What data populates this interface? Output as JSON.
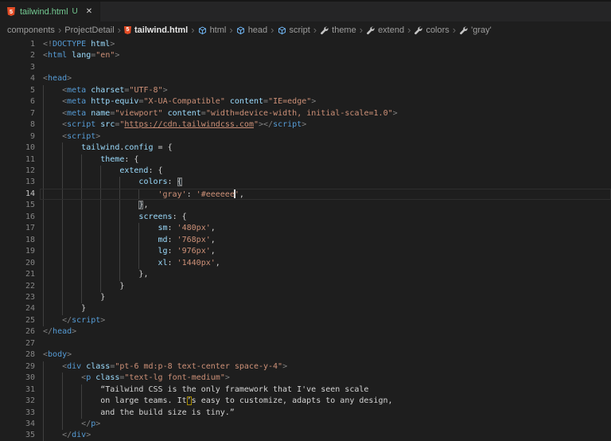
{
  "tab": {
    "label": "tailwind.html",
    "git_status": "U",
    "close_glyph": "✕",
    "file_icon_text": "5"
  },
  "breadcrumb": {
    "separator": "›",
    "items": [
      {
        "label": "components",
        "icon": null
      },
      {
        "label": "ProjectDetail",
        "icon": null
      },
      {
        "label": "tailwind.html",
        "icon": "html5",
        "emphasis": true
      },
      {
        "label": "html",
        "icon": "cube"
      },
      {
        "label": "head",
        "icon": "cube"
      },
      {
        "label": "script",
        "icon": "cube"
      },
      {
        "label": "theme",
        "icon": "wrench"
      },
      {
        "label": "extend",
        "icon": "wrench"
      },
      {
        "label": "colors",
        "icon": "wrench"
      },
      {
        "label": "'gray'",
        "icon": "wrench"
      }
    ]
  },
  "editor": {
    "active_line": 14,
    "token_colors": {
      "p": "#808080",
      "t": "#569cd6",
      "a": "#9cdcfe",
      "s": "#ce9178",
      "k": "#9cdcfe",
      "w": "#d4d4d4"
    },
    "ui_colors": {
      "background": "#1e1e1e",
      "tab_bar": "#252526",
      "untracked_green": "#73c991",
      "line_number": "#858585",
      "active_line_number": "#c6c6c6",
      "indent_guide": "#404040"
    },
    "lines": [
      {
        "n": 1,
        "indent": 0,
        "tokens": [
          [
            "<!",
            "p"
          ],
          [
            "DOCTYPE",
            "t"
          ],
          [
            " ",
            "w"
          ],
          [
            "html",
            "a"
          ],
          [
            ">",
            "p"
          ]
        ]
      },
      {
        "n": 2,
        "indent": 0,
        "tokens": [
          [
            "<",
            "p"
          ],
          [
            "html",
            "t"
          ],
          [
            " ",
            "w"
          ],
          [
            "lang",
            "a"
          ],
          [
            "=",
            "p"
          ],
          [
            "\"en\"",
            "s"
          ],
          [
            ">",
            "p"
          ]
        ]
      },
      {
        "n": 3,
        "indent": 0,
        "tokens": []
      },
      {
        "n": 4,
        "indent": 0,
        "tokens": [
          [
            "<",
            "p"
          ],
          [
            "head",
            "t"
          ],
          [
            ">",
            "p"
          ]
        ]
      },
      {
        "n": 5,
        "indent": 4,
        "tokens": [
          [
            "    ",
            "w"
          ],
          [
            "<",
            "p"
          ],
          [
            "meta",
            "t"
          ],
          [
            " ",
            "w"
          ],
          [
            "charset",
            "a"
          ],
          [
            "=",
            "p"
          ],
          [
            "\"UTF-8\"",
            "s"
          ],
          [
            ">",
            "p"
          ]
        ]
      },
      {
        "n": 6,
        "indent": 4,
        "tokens": [
          [
            "    ",
            "w"
          ],
          [
            "<",
            "p"
          ],
          [
            "meta",
            "t"
          ],
          [
            " ",
            "w"
          ],
          [
            "http-equiv",
            "a"
          ],
          [
            "=",
            "p"
          ],
          [
            "\"X-UA-Compatible\"",
            "s"
          ],
          [
            " ",
            "w"
          ],
          [
            "content",
            "a"
          ],
          [
            "=",
            "p"
          ],
          [
            "\"IE=edge\"",
            "s"
          ],
          [
            ">",
            "p"
          ]
        ]
      },
      {
        "n": 7,
        "indent": 4,
        "tokens": [
          [
            "    ",
            "w"
          ],
          [
            "<",
            "p"
          ],
          [
            "meta",
            "t"
          ],
          [
            " ",
            "w"
          ],
          [
            "name",
            "a"
          ],
          [
            "=",
            "p"
          ],
          [
            "\"viewport\"",
            "s"
          ],
          [
            " ",
            "w"
          ],
          [
            "content",
            "a"
          ],
          [
            "=",
            "p"
          ],
          [
            "\"width=device-width, initial-scale=1.0\"",
            "s"
          ],
          [
            ">",
            "p"
          ]
        ]
      },
      {
        "n": 8,
        "indent": 4,
        "tokens": [
          [
            "    ",
            "w"
          ],
          [
            "<",
            "p"
          ],
          [
            "script",
            "t"
          ],
          [
            " ",
            "w"
          ],
          [
            "src",
            "a"
          ],
          [
            "=",
            "p"
          ],
          [
            "\"",
            "s"
          ],
          [
            "https://cdn.tailwindcss.com",
            "s",
            "link"
          ],
          [
            "\"",
            "s"
          ],
          [
            ">",
            "p"
          ],
          [
            "</",
            "p"
          ],
          [
            "script",
            "t"
          ],
          [
            ">",
            "p"
          ]
        ]
      },
      {
        "n": 9,
        "indent": 4,
        "tokens": [
          [
            "    ",
            "w"
          ],
          [
            "<",
            "p"
          ],
          [
            "script",
            "t"
          ],
          [
            ">",
            "p"
          ]
        ]
      },
      {
        "n": 10,
        "indent": 8,
        "tokens": [
          [
            "        ",
            "w"
          ],
          [
            "tailwind",
            "k"
          ],
          [
            ".",
            "w"
          ],
          [
            "config",
            "k"
          ],
          [
            " = ",
            "w"
          ],
          [
            "{",
            "w"
          ]
        ]
      },
      {
        "n": 11,
        "indent": 12,
        "tokens": [
          [
            "            ",
            "w"
          ],
          [
            "theme",
            "k"
          ],
          [
            ": ",
            "w"
          ],
          [
            "{",
            "w"
          ]
        ]
      },
      {
        "n": 12,
        "indent": 16,
        "tokens": [
          [
            "                ",
            "w"
          ],
          [
            "extend",
            "k"
          ],
          [
            ": ",
            "w"
          ],
          [
            "{",
            "w"
          ]
        ]
      },
      {
        "n": 13,
        "indent": 20,
        "tokens": [
          [
            "                    ",
            "w"
          ],
          [
            "colors",
            "k"
          ],
          [
            ": ",
            "w"
          ],
          [
            "{",
            "w",
            "match"
          ]
        ]
      },
      {
        "n": 14,
        "indent": 24,
        "tokens": [
          [
            "                        ",
            "w"
          ],
          [
            "'gray'",
            "s"
          ],
          [
            ": ",
            "w"
          ],
          [
            "'#eeeeee",
            "s"
          ],
          [
            "",
            "w",
            "cursor"
          ],
          [
            "'",
            "s"
          ],
          [
            ",",
            "w"
          ]
        ]
      },
      {
        "n": 15,
        "indent": 20,
        "tokens": [
          [
            "                    ",
            "w"
          ],
          [
            "}",
            "w",
            "match"
          ],
          [
            ",",
            "w"
          ]
        ]
      },
      {
        "n": 16,
        "indent": 20,
        "tokens": [
          [
            "                    ",
            "w"
          ],
          [
            "screens",
            "k"
          ],
          [
            ": ",
            "w"
          ],
          [
            "{",
            "w"
          ]
        ]
      },
      {
        "n": 17,
        "indent": 24,
        "tokens": [
          [
            "                        ",
            "w"
          ],
          [
            "sm",
            "k"
          ],
          [
            ": ",
            "w"
          ],
          [
            "'480px'",
            "s"
          ],
          [
            ",",
            "w"
          ]
        ]
      },
      {
        "n": 18,
        "indent": 24,
        "tokens": [
          [
            "                        ",
            "w"
          ],
          [
            "md",
            "k"
          ],
          [
            ": ",
            "w"
          ],
          [
            "'768px'",
            "s"
          ],
          [
            ",",
            "w"
          ]
        ]
      },
      {
        "n": 19,
        "indent": 24,
        "tokens": [
          [
            "                        ",
            "w"
          ],
          [
            "lg",
            "k"
          ],
          [
            ": ",
            "w"
          ],
          [
            "'976px'",
            "s"
          ],
          [
            ",",
            "w"
          ]
        ]
      },
      {
        "n": 20,
        "indent": 24,
        "tokens": [
          [
            "                        ",
            "w"
          ],
          [
            "xl",
            "k"
          ],
          [
            ": ",
            "w"
          ],
          [
            "'1440px'",
            "s"
          ],
          [
            ",",
            "w"
          ]
        ]
      },
      {
        "n": 21,
        "indent": 20,
        "tokens": [
          [
            "                    ",
            "w"
          ],
          [
            "},",
            "w"
          ]
        ]
      },
      {
        "n": 22,
        "indent": 16,
        "tokens": [
          [
            "                ",
            "w"
          ],
          [
            "}",
            "w"
          ]
        ]
      },
      {
        "n": 23,
        "indent": 12,
        "tokens": [
          [
            "            ",
            "w"
          ],
          [
            "}",
            "w"
          ]
        ]
      },
      {
        "n": 24,
        "indent": 8,
        "tokens": [
          [
            "        ",
            "w"
          ],
          [
            "}",
            "w"
          ]
        ]
      },
      {
        "n": 25,
        "indent": 4,
        "tokens": [
          [
            "    ",
            "w"
          ],
          [
            "</",
            "p"
          ],
          [
            "script",
            "t"
          ],
          [
            ">",
            "p"
          ]
        ]
      },
      {
        "n": 26,
        "indent": 0,
        "tokens": [
          [
            "</",
            "p"
          ],
          [
            "head",
            "t"
          ],
          [
            ">",
            "p"
          ]
        ]
      },
      {
        "n": 27,
        "indent": 0,
        "tokens": []
      },
      {
        "n": 28,
        "indent": 0,
        "tokens": [
          [
            "<",
            "p"
          ],
          [
            "body",
            "t"
          ],
          [
            ">",
            "p"
          ]
        ]
      },
      {
        "n": 29,
        "indent": 4,
        "tokens": [
          [
            "    ",
            "w"
          ],
          [
            "<",
            "p"
          ],
          [
            "div",
            "t"
          ],
          [
            " ",
            "w"
          ],
          [
            "class",
            "a"
          ],
          [
            "=",
            "p"
          ],
          [
            "\"pt-6 md:p-8 text-center space-y-4\"",
            "s"
          ],
          [
            ">",
            "p"
          ]
        ]
      },
      {
        "n": 30,
        "indent": 8,
        "tokens": [
          [
            "        ",
            "w"
          ],
          [
            "<",
            "p"
          ],
          [
            "p",
            "t"
          ],
          [
            " ",
            "w"
          ],
          [
            "class",
            "a"
          ],
          [
            "=",
            "p"
          ],
          [
            "\"text-lg font-medium\"",
            "s"
          ],
          [
            ">",
            "p"
          ]
        ]
      },
      {
        "n": 31,
        "indent": 12,
        "tokens": [
          [
            "            ",
            "w"
          ],
          [
            "“Tailwind CSS is the only framework that I've seen scale",
            "w"
          ]
        ]
      },
      {
        "n": 32,
        "indent": 12,
        "tokens": [
          [
            "            ",
            "w"
          ],
          [
            "on large teams. It",
            "w"
          ],
          [
            "’",
            "w",
            "unicode"
          ],
          [
            "s easy to customize, adapts to any design,",
            "w"
          ]
        ]
      },
      {
        "n": 33,
        "indent": 12,
        "tokens": [
          [
            "            ",
            "w"
          ],
          [
            "and the build size is tiny.”",
            "w"
          ]
        ]
      },
      {
        "n": 34,
        "indent": 8,
        "tokens": [
          [
            "        ",
            "w"
          ],
          [
            "</",
            "p"
          ],
          [
            "p",
            "t"
          ],
          [
            ">",
            "p"
          ]
        ]
      },
      {
        "n": 35,
        "indent": 4,
        "tokens": [
          [
            "    ",
            "w"
          ],
          [
            "</",
            "p"
          ],
          [
            "div",
            "t"
          ],
          [
            ">",
            "p"
          ]
        ]
      }
    ]
  }
}
